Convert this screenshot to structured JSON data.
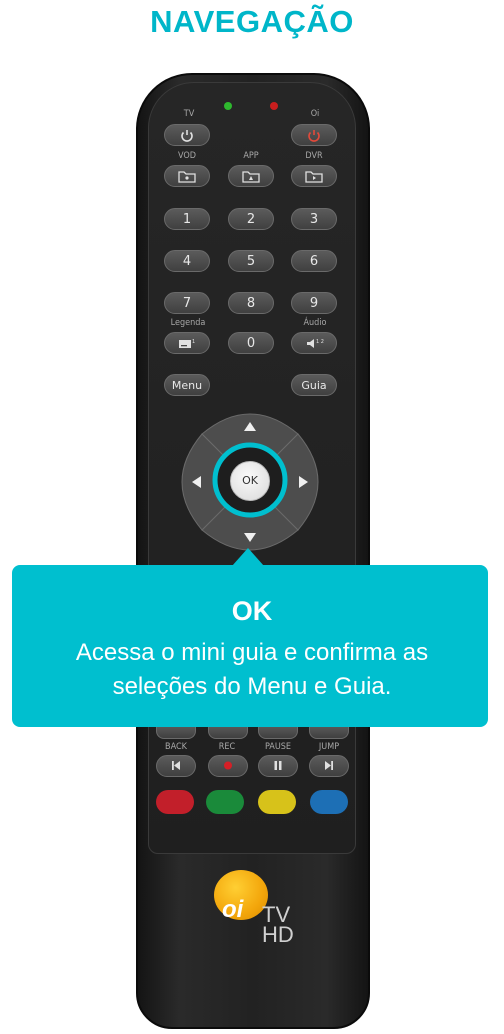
{
  "header": {
    "title": "NAVEGAÇÃO"
  },
  "remote": {
    "labels": {
      "tv": "TV",
      "oi": "Oi",
      "vod": "VOD",
      "app": "APP",
      "dvr": "DVR",
      "legenda": "Legenda",
      "audio": "Áudio",
      "back": "BACK",
      "rec": "REC",
      "pause": "PAUSE",
      "jump": "JUMP"
    },
    "digits": [
      "1",
      "2",
      "3",
      "4",
      "5",
      "6",
      "7",
      "8",
      "9",
      "0"
    ],
    "menu_label": "Menu",
    "guia_label": "Guia",
    "ok_label": "OK",
    "logo": {
      "brand": "oi",
      "tv": "TV",
      "hd": "HD"
    },
    "colors": {
      "red": "#c21f2a",
      "green": "#1a8a3a",
      "yellow": "#d7c21a",
      "blue": "#1d6fb5",
      "led_green": "#2eb82e",
      "led_red": "#c81e1e"
    }
  },
  "tooltip": {
    "title": "OK",
    "body_line1": "Acessa o mini guia e confirma as",
    "body_line2": "seleções do Menu e Guia.",
    "color": "#00bfcf"
  },
  "accent": "#00b6c9"
}
